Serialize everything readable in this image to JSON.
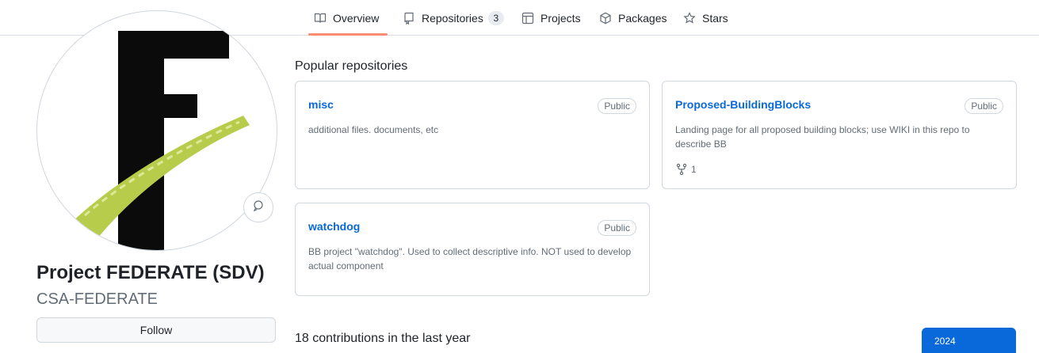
{
  "nav": {
    "tabs": [
      {
        "label": "Overview",
        "icon": "book-icon",
        "selected": true
      },
      {
        "label": "Repositories",
        "icon": "repo-icon",
        "count": "3"
      },
      {
        "label": "Projects",
        "icon": "table-icon"
      },
      {
        "label": "Packages",
        "icon": "package-icon"
      },
      {
        "label": "Stars",
        "icon": "star-icon"
      }
    ],
    "underline_color": "#fd8c73"
  },
  "profile": {
    "avatar_icon": "federate-logo",
    "name": "Project FEDERATE (SDV)",
    "login": "CSA-FEDERATE",
    "follow_label": "Follow"
  },
  "popular": {
    "title": "Popular repositories",
    "repos": [
      {
        "name": "misc",
        "visibility": "Public",
        "description": "additional files. documents, etc"
      },
      {
        "name": "Proposed-BuildingBlocks",
        "visibility": "Public",
        "description": "Landing page for all proposed building blocks; use WIKI in this repo to describe BB",
        "forks": "1"
      },
      {
        "name": "watchdog",
        "visibility": "Public",
        "description": "BB project \"watchdog\". Used to collect descriptive info. NOT used to develop actual component"
      }
    ]
  },
  "contributions": {
    "title": "18 contributions in the last year",
    "year": "2024"
  },
  "colors": {
    "link": "#0969da",
    "muted": "#636c76",
    "border": "#d0d7de",
    "year_button": "#0969da"
  }
}
